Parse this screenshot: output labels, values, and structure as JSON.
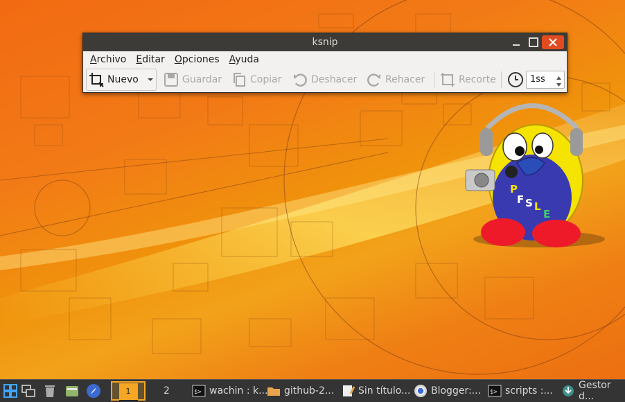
{
  "window": {
    "title": "ksnip",
    "menu": [
      {
        "accel": "A",
        "rest": "rchivo"
      },
      {
        "accel": "E",
        "rest": "ditar"
      },
      {
        "accel": "O",
        "rest": "pciones"
      },
      {
        "accel": "A",
        "rest": "yuda"
      }
    ],
    "toolbar": {
      "new_label": "Nuevo",
      "save_label": "Guardar",
      "copy_label": "Copiar",
      "undo_label": "Deshacer",
      "redo_label": "Rehacer",
      "crop_label": "Recorte",
      "delay_value": "1ss"
    }
  },
  "wallpaper": {
    "mascot_letters": [
      "P",
      "F",
      "S",
      "L",
      "E"
    ]
  },
  "taskbar": {
    "workspace_1": "1",
    "workspace_2": "2",
    "tasks": [
      {
        "icon": "terminal-icon",
        "label": "wachin : k..."
      },
      {
        "icon": "folder-icon",
        "label": "github-2..."
      },
      {
        "icon": "text-editor-icon",
        "label": "Sin título..."
      },
      {
        "icon": "chrome-icon",
        "label": "Blogger:..."
      },
      {
        "icon": "terminal-icon",
        "label": "scripts :..."
      },
      {
        "icon": "update-manager-icon",
        "label": "Gestor d..."
      }
    ]
  },
  "colors": {
    "titlebar": "#3c3b37",
    "close_button": "#e24b1f",
    "taskbar": "#343434",
    "active_workspace": "#f5a623"
  }
}
